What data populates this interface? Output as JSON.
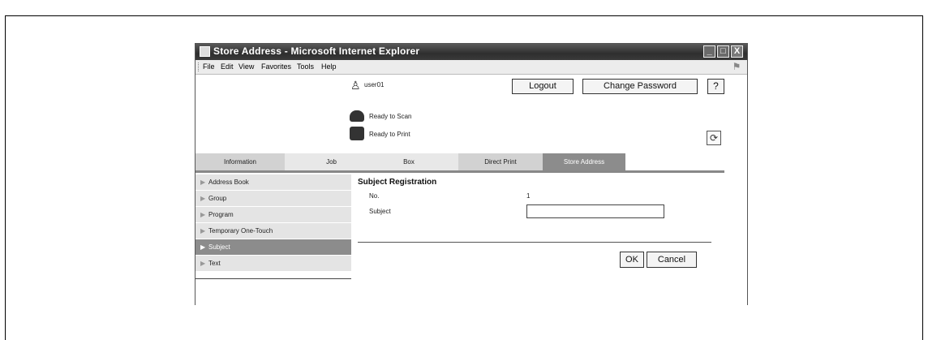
{
  "window": {
    "title": "Store Address - Microsoft Internet Explorer",
    "buttons": {
      "minimize": "_",
      "maximize": "□",
      "close": "X"
    }
  },
  "menu": [
    "File",
    "Edit",
    "View",
    "Favorites",
    "Tools",
    "Help"
  ],
  "header": {
    "user": "user01",
    "logout": "Logout",
    "change_password": "Change Password",
    "help": "?",
    "scan_status": "Ready to Scan",
    "print_status": "Ready to Print",
    "refresh_icon": "refresh-icon"
  },
  "tabs": [
    {
      "label": "Information",
      "active": false
    },
    {
      "label": "Job",
      "active": false
    },
    {
      "label": "Box",
      "active": false
    },
    {
      "label": "Direct Print",
      "active": false
    },
    {
      "label": "Store Address",
      "active": true
    }
  ],
  "sidebar": [
    {
      "label": "Address Book",
      "active": false
    },
    {
      "label": "Group",
      "active": false
    },
    {
      "label": "Program",
      "active": false
    },
    {
      "label": "Temporary One-Touch",
      "active": false
    },
    {
      "label": "Subject",
      "active": true
    },
    {
      "label": "Text",
      "active": false
    }
  ],
  "main": {
    "title": "Subject Registration",
    "no_label": "No.",
    "no_value": "1",
    "subject_label": "Subject",
    "subject_value": "",
    "ok": "OK",
    "cancel": "Cancel"
  },
  "colors": {
    "active_tab": "#8c8c8c",
    "titlebar": "#3a3a3a",
    "sidebar": "#e4e4e4"
  }
}
